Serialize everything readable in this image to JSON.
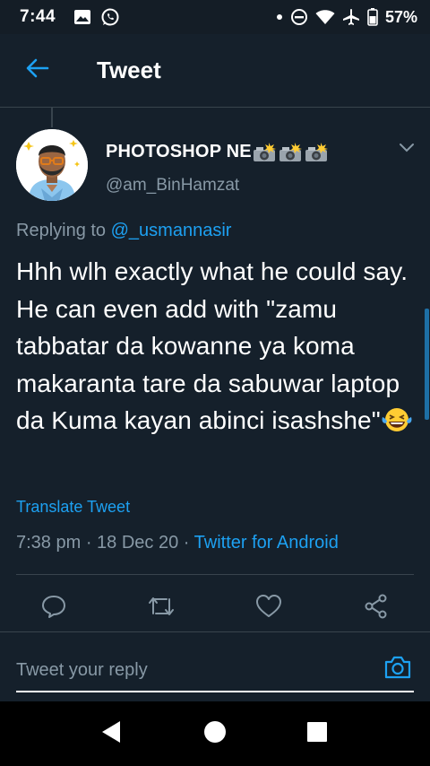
{
  "status_bar": {
    "time": "7:44",
    "battery": "57%",
    "left_icons": [
      "image-icon",
      "whatsapp-icon"
    ],
    "right_icons": [
      "dot-icon",
      "do-not-disturb-icon",
      "wifi-icon",
      "airplane-icon",
      "battery-icon"
    ]
  },
  "header": {
    "title": "Tweet",
    "back_icon": "back-arrow-icon"
  },
  "tweet": {
    "author": {
      "display_name": "PHOTOSHOP NE",
      "name_emoji": "camera-flash-emoji",
      "username": "@am_BinHamzat"
    },
    "replying_prefix": "Replying to",
    "replying_to": "@_usmannasir",
    "text": "Hhh wlh exactly what he could say. He can even add with \"zamu tabbatar da kowanne ya koma makaranta tare da sabuwar laptop da Kuma kayan abinci isashshe\"",
    "text_emoji": "laughing-tears-emoji",
    "translate_label": "Translate Tweet",
    "time": "7:38 pm",
    "date": "18 Dec 20",
    "source": "Twitter for Android",
    "separator": " · "
  },
  "actions": [
    "reply-icon",
    "retweet-icon",
    "like-icon",
    "share-icon"
  ],
  "reply_box": {
    "placeholder": "Tweet your reply",
    "camera_icon": "camera-icon"
  },
  "nav": [
    "back-triangle-icon",
    "home-circle-icon",
    "recents-square-icon"
  ],
  "colors": {
    "background": "#15202b",
    "accent": "#1da1f2",
    "secondary_text": "#8899a6",
    "divider": "#38444d"
  }
}
